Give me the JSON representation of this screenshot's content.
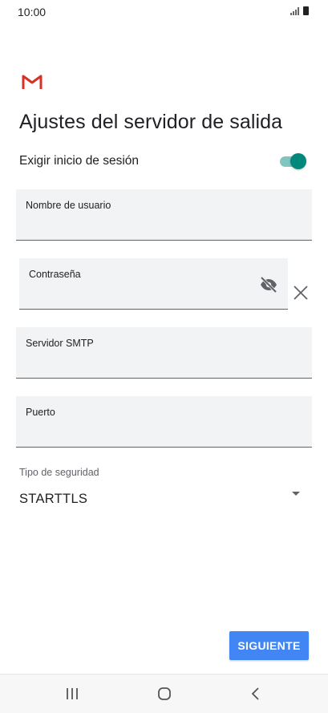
{
  "status_bar": {
    "time": "10:00"
  },
  "app": {
    "logo_icon": "gmail-icon"
  },
  "header": {
    "title": "Ajustes del servidor de salida"
  },
  "login_toggle": {
    "label": "Exigir inicio de sesión",
    "enabled": true,
    "color": "#00897b"
  },
  "fields": {
    "username": {
      "label": "Nombre de usuario",
      "value": ""
    },
    "password": {
      "label": "Contraseña",
      "value": "",
      "visibility_icon": "eye-off-icon",
      "clear_icon": "close-icon"
    },
    "smtp_server": {
      "label": "Servidor SMTP",
      "value": ""
    },
    "port": {
      "label": "Puerto",
      "value": ""
    }
  },
  "security": {
    "label": "Tipo de seguridad",
    "value": "STARTTLS",
    "dropdown_icon": "caret-down-icon"
  },
  "actions": {
    "next_label": "SIGUIENTE",
    "next_color": "#4285f4"
  },
  "nav_bar": {
    "recents_icon": "recents-icon",
    "home_icon": "home-icon",
    "back_icon": "back-icon"
  }
}
